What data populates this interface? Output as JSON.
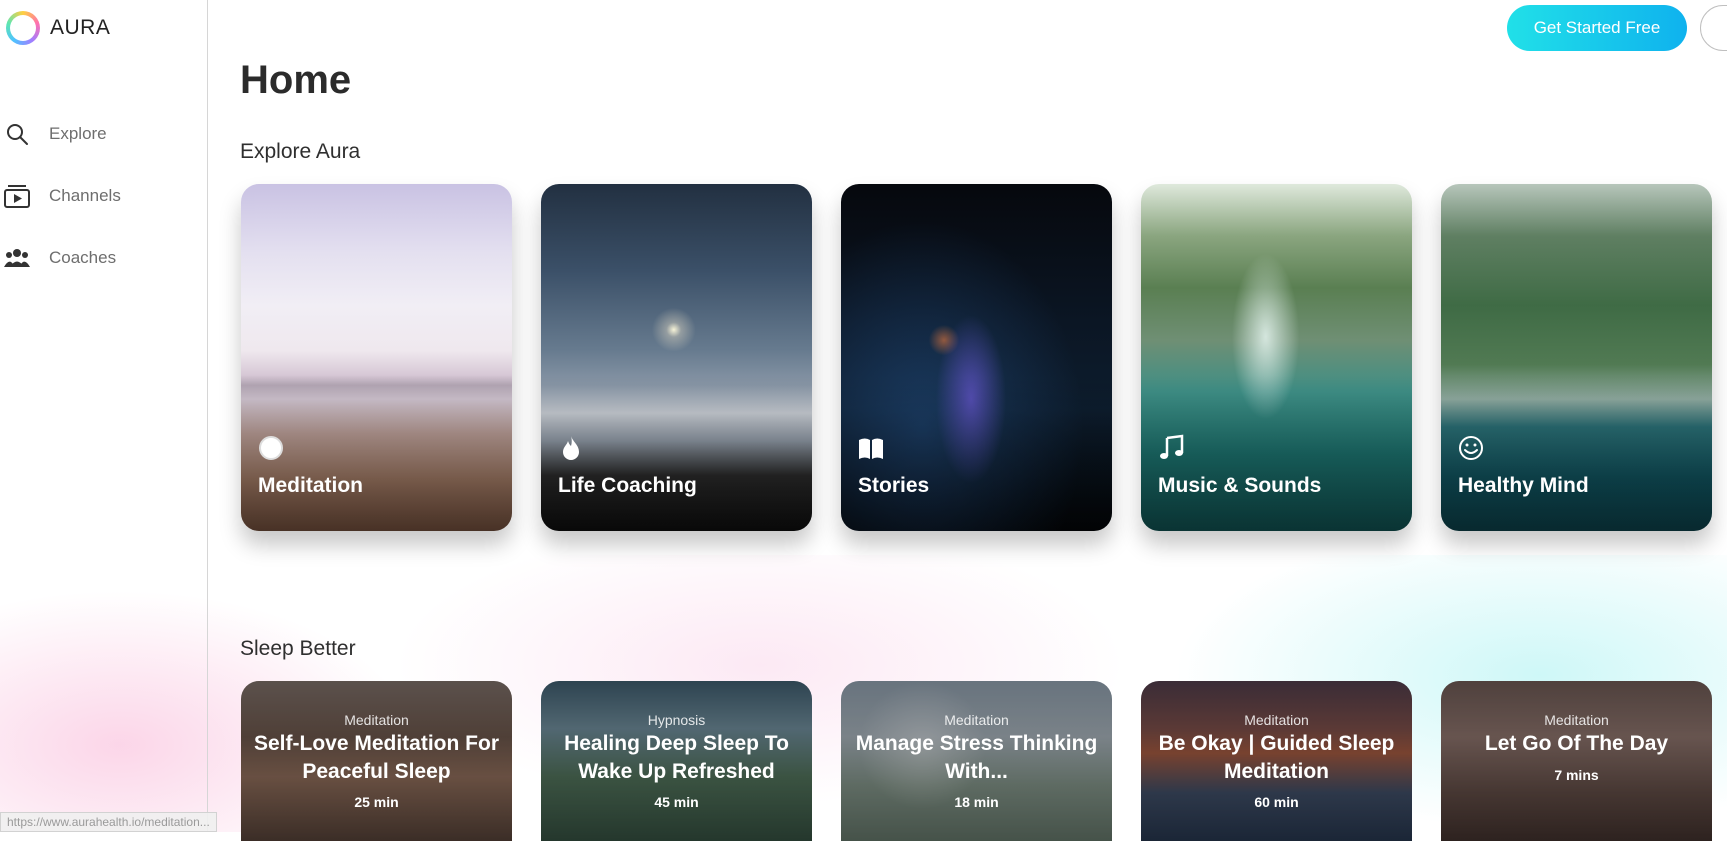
{
  "brand": {
    "name": "AURA"
  },
  "sidebar": {
    "items": [
      {
        "label": "Explore",
        "icon": "search-icon"
      },
      {
        "label": "Channels",
        "icon": "channels-icon"
      },
      {
        "label": "Coaches",
        "icon": "coaches-icon"
      }
    ]
  },
  "header": {
    "cta_label": "Get Started Free"
  },
  "main": {
    "title": "Home",
    "explore": {
      "title": "Explore Aura",
      "cards": [
        {
          "label": "Meditation",
          "icon": "circle-icon"
        },
        {
          "label": "Life Coaching",
          "icon": "flame-icon"
        },
        {
          "label": "Stories",
          "icon": "book-icon"
        },
        {
          "label": "Music & Sounds",
          "icon": "music-note-icon"
        },
        {
          "label": "Healthy Mind",
          "icon": "smile-icon"
        }
      ]
    },
    "sleep": {
      "title": "Sleep Better",
      "cards": [
        {
          "category": "Meditation",
          "title": "Self-Love Meditation For Peaceful Sleep",
          "duration": "25 min"
        },
        {
          "category": "Hypnosis",
          "title": "Healing Deep Sleep To Wake Up Refreshed",
          "duration": "45 min"
        },
        {
          "category": "Meditation",
          "title": "Manage Stress Thinking With...",
          "duration": "18 min"
        },
        {
          "category": "Meditation",
          "title": "Be Okay | Guided Sleep Meditation",
          "duration": "60 min"
        },
        {
          "category": "Meditation",
          "title": "Let Go Of The Day",
          "duration": "7 mins"
        }
      ]
    }
  },
  "status_bar": {
    "url": "https://www.aurahealth.io/meditation..."
  },
  "colors": {
    "cta_start": "#21e0e8",
    "cta_end": "#0fb2ee",
    "sidebar_border": "#d6d6d6"
  }
}
